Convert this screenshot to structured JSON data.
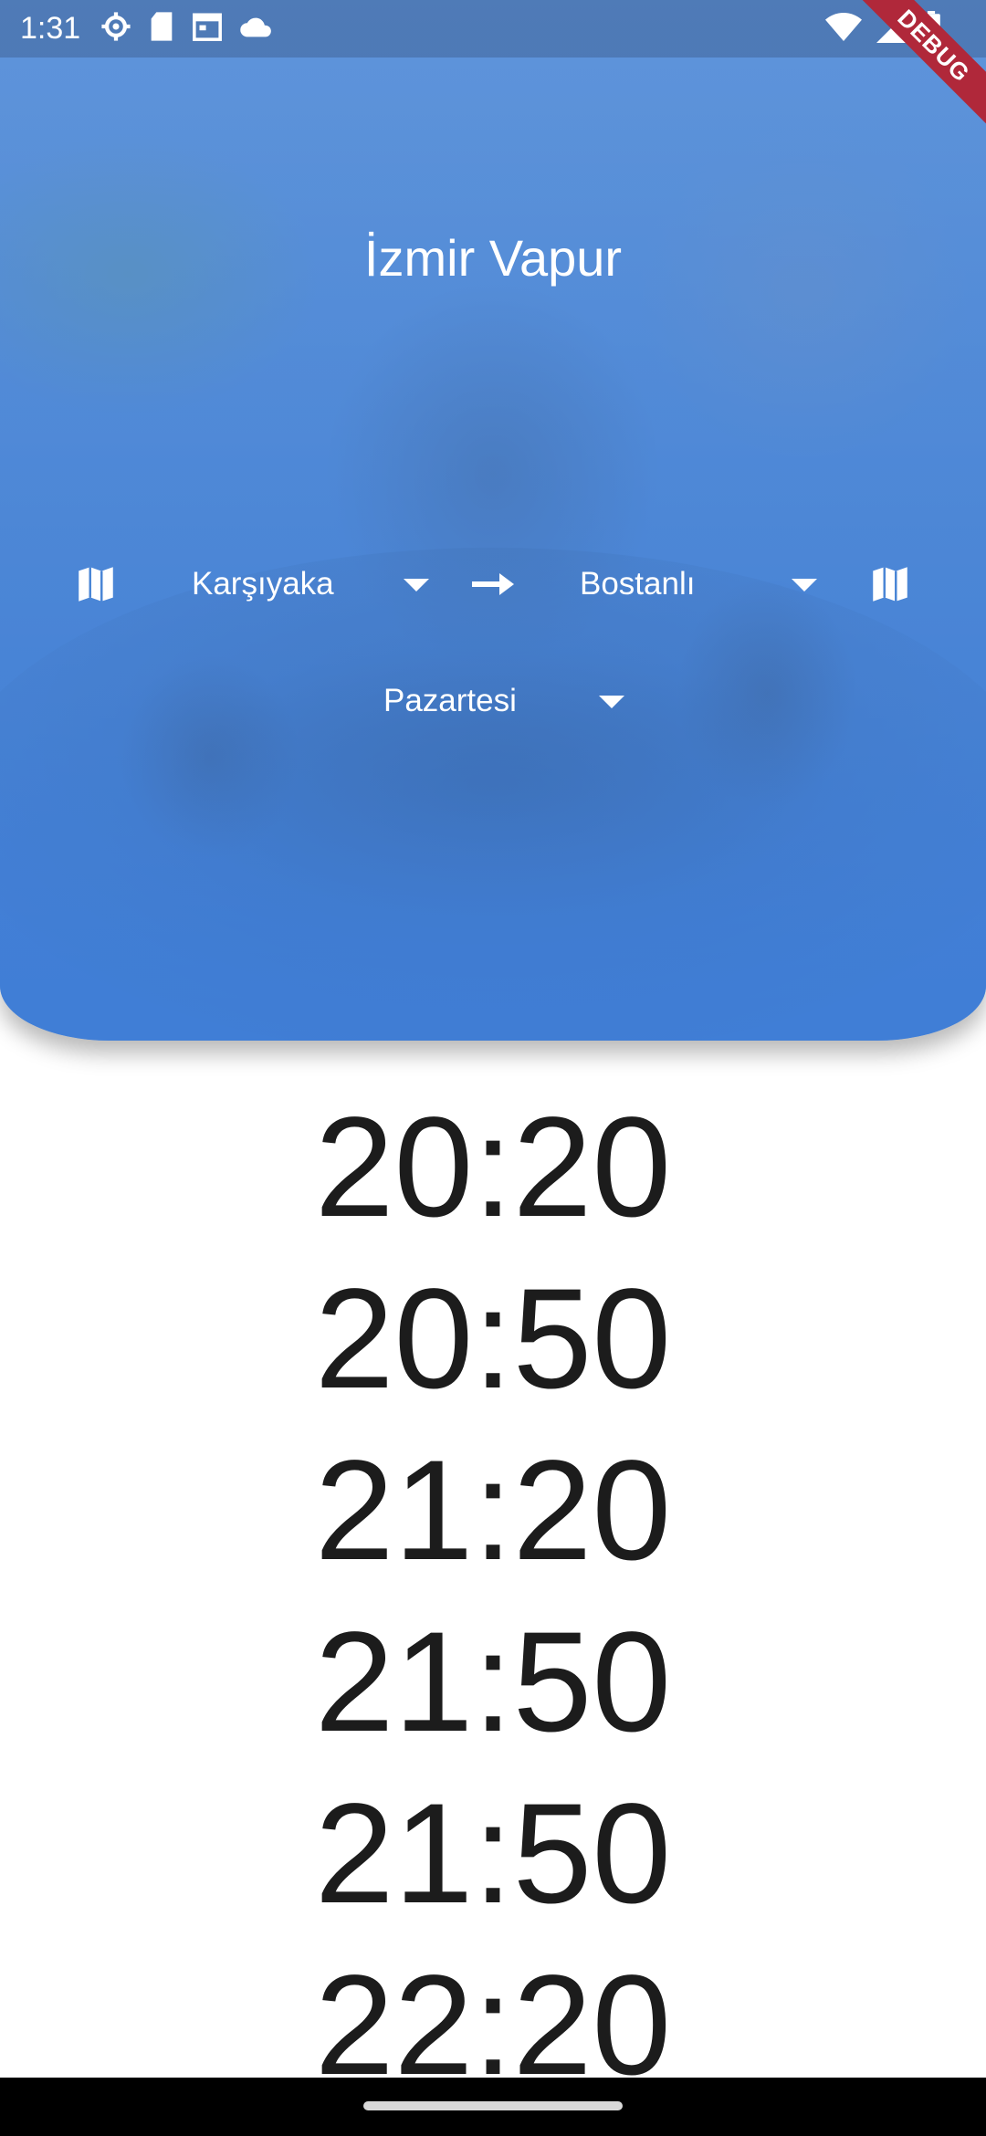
{
  "status_bar": {
    "time": "1:31",
    "left_icons": [
      "settings-gear-icon",
      "sd-card-icon",
      "calendar-icon",
      "cloud-icon"
    ],
    "right_icons": [
      "wifi-icon",
      "signal-icon",
      "battery-icon"
    ]
  },
  "debug_banner": "DEBUG",
  "header": {
    "title": "İzmir Vapur",
    "from_pier": "Karşıyaka",
    "to_pier": "Bostanlı",
    "day": "Pazartesi",
    "map_icon": "map-icon",
    "arrow_icon": "arrow-right-icon",
    "accent_color": "#4a86d6"
  },
  "departures": [
    "20:20",
    "20:50",
    "21:20",
    "21:50",
    "21:50",
    "22:20"
  ]
}
